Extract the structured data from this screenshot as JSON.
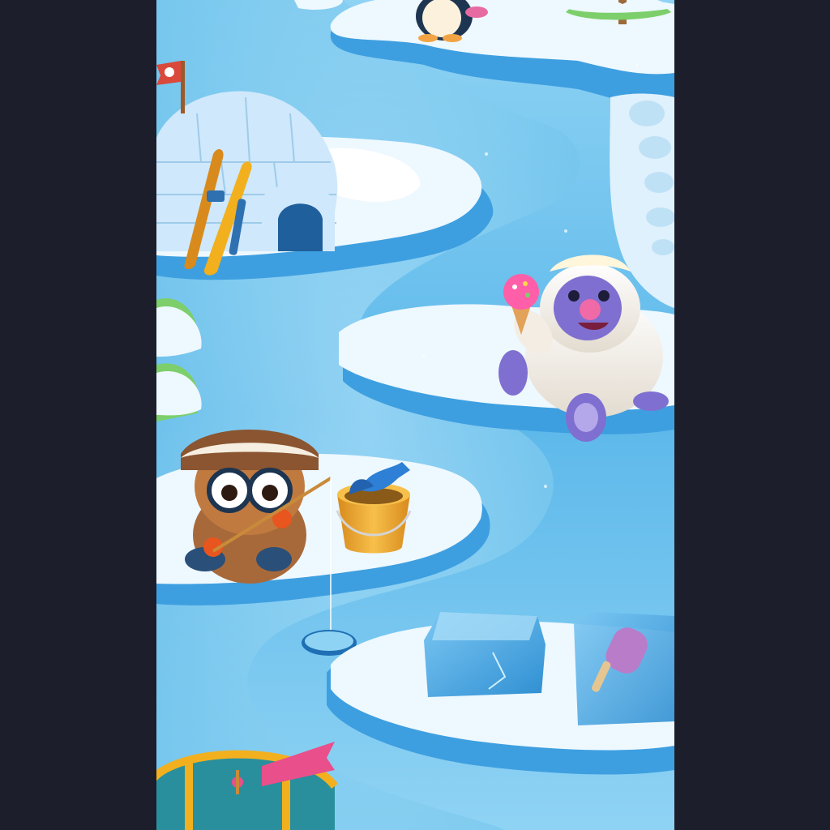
{
  "screen": {
    "kind": "game-map",
    "theme": "ice-world",
    "side_bar_color": "#1c1f2b",
    "colors": {
      "ice_deep": "#2f8fd2",
      "ice_light": "#8fd3f4",
      "snow": "#eef8ff",
      "igloo": "#cfe8fb",
      "wood": "#c9772b",
      "gold": "#f2b01e",
      "yeti_fur": "#f3ede3",
      "yeti_face": "#7f6fd0",
      "ice_cream_pink": "#ff5fa8",
      "bucket": "#f0a72a",
      "fish": "#2e7fd6",
      "ribbon": "#e94f8b"
    }
  },
  "scene": {
    "objects": [
      {
        "name": "igloo",
        "icon": "igloo-icon"
      },
      {
        "name": "flag",
        "icon": "flag-icon"
      },
      {
        "name": "skis",
        "icon": "skis-icon"
      },
      {
        "name": "penguin",
        "icon": "penguin-icon"
      },
      {
        "name": "snowy-tree",
        "icon": "tree-icon"
      },
      {
        "name": "yeti-with-ice-cream",
        "icon": "yeti-icon"
      },
      {
        "name": "fisher-character",
        "icon": "fisher-icon"
      },
      {
        "name": "fish-bucket",
        "icon": "bucket-icon"
      },
      {
        "name": "ice-hole",
        "icon": "ice-hole-icon"
      },
      {
        "name": "ice-block",
        "icon": "ice-block-icon"
      },
      {
        "name": "frozen-popsicle",
        "icon": "popsicle-icon"
      },
      {
        "name": "treasure-chest",
        "icon": "chest-icon"
      }
    ]
  }
}
